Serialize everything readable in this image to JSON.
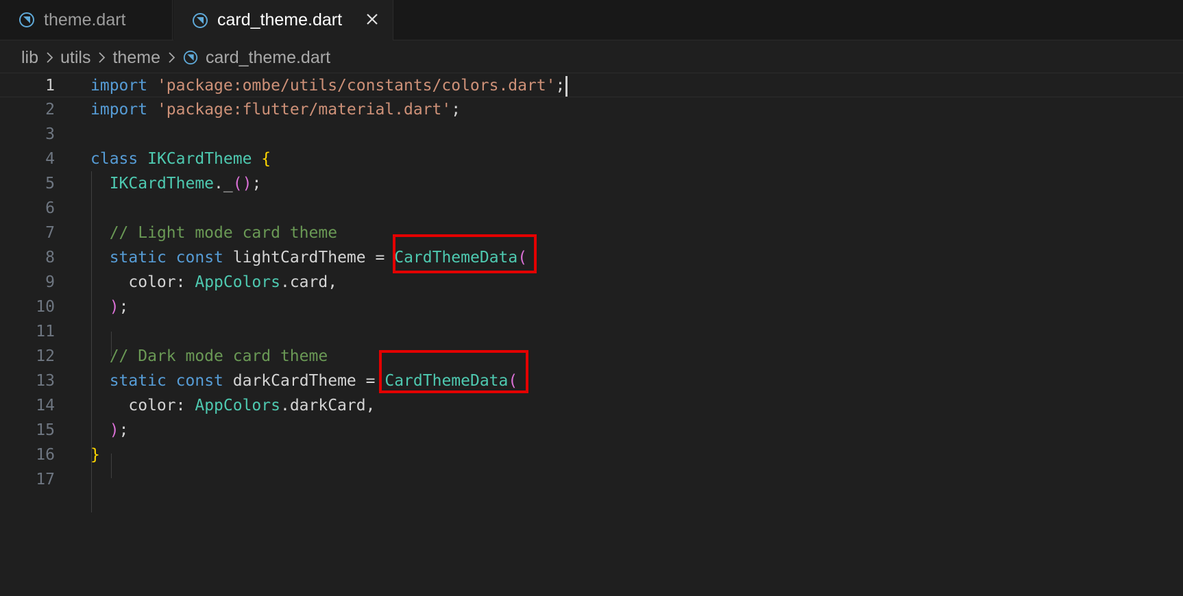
{
  "tabs": [
    {
      "label": "theme.dart",
      "icon": "dart-file-icon",
      "active": false
    },
    {
      "label": "card_theme.dart",
      "icon": "dart-file-icon",
      "active": true
    }
  ],
  "breadcrumb": [
    "lib",
    "utils",
    "theme",
    "card_theme.dart"
  ],
  "line_numbers": [
    "1",
    "2",
    "3",
    "4",
    "5",
    "6",
    "7",
    "8",
    "9",
    "10",
    "11",
    "12",
    "13",
    "14",
    "15",
    "16",
    "17"
  ],
  "code": {
    "l1_import": "import",
    "l1_str": "'package:ombe/utils/constants/colors.dart'",
    "l1_semi": ";",
    "l2_import": "import",
    "l2_str": "'package:flutter/material.dart'",
    "l2_semi": ";",
    "l4_class": "class",
    "l4_name": "IKCardTheme",
    "l4_brace": "{",
    "l5_name": "IKCardTheme",
    "l5_dot": "._",
    "l5_parens": "()",
    "l5_semi": ";",
    "l7_comment": "// Light mode card theme",
    "l8_static": "static",
    "l8_const": "const",
    "l8_var": "lightCardTheme",
    "l8_eq": "=",
    "l8_type": "CardThemeData",
    "l8_paren": "(",
    "l9_prop": "color:",
    "l9_cls": "AppColors",
    "l9_rest": ".card,",
    "l10_paren": ")",
    "l10_semi": ";",
    "l12_comment": "// Dark mode card theme",
    "l13_static": "static",
    "l13_const": "const",
    "l13_var": "darkCardTheme",
    "l13_eq": "=",
    "l13_type": "CardThemeData",
    "l13_paren": "(",
    "l14_prop": "color:",
    "l14_cls": "AppColors",
    "l14_rest": ".darkCard,",
    "l15_paren": ")",
    "l15_semi": ";",
    "l16_brace": "}"
  },
  "colors": {
    "keyword": "#569cd6",
    "string": "#ce9178",
    "class": "#4ec9b0",
    "comment": "#6a9955",
    "highlight_box": "#e30000"
  }
}
